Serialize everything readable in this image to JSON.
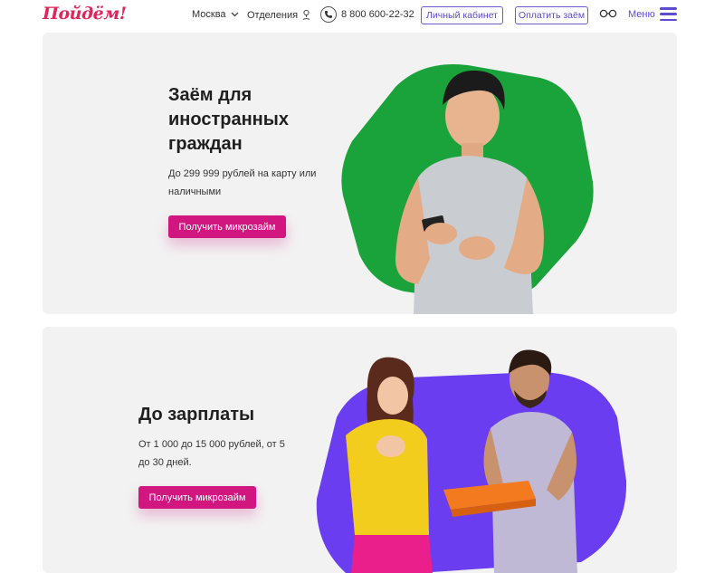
{
  "header": {
    "logo_text": "Пойдём!",
    "city": "Москва",
    "branches": "Отделения",
    "phone": "8 800 600-22-32",
    "cabinet_button": "Личный кабинет",
    "pay_button": "Оплатить заём",
    "menu_label": "Меню"
  },
  "cards": [
    {
      "title": "Заём для иностранных граждан",
      "subtitle": "До 299 999 рублей на карту или наличными",
      "button": "Получить микрозайм",
      "blob_color": "#1aa33a"
    },
    {
      "title": "До зарплаты",
      "subtitle": "От 1 000 до 15 000 рублей, от 5 до 30 дней.",
      "button": "Получить микрозайм",
      "blob_color": "#6a3df0"
    }
  ],
  "colors": {
    "brand_red": "#e3245b",
    "accent_purple": "#5b4bd0",
    "primary_button": "#d1177f",
    "card_bg": "#f2f2f2"
  },
  "icons": [
    "chevron-down-icon",
    "location-pin-icon",
    "phone-icon",
    "glasses-icon",
    "hamburger-icon"
  ]
}
